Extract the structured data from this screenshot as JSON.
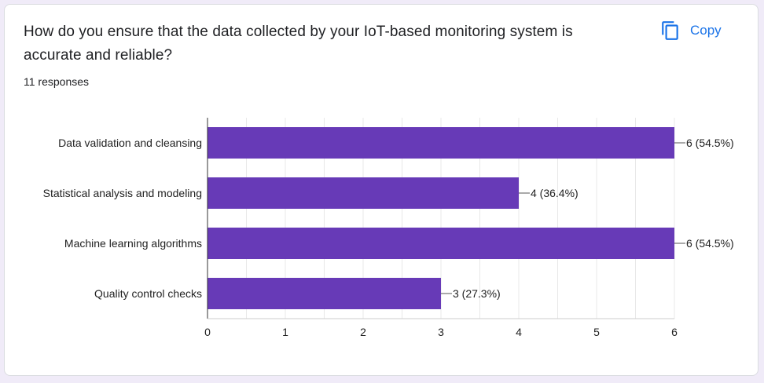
{
  "question": {
    "title": "How do you ensure that the data collected by your IoT-based monitoring system is accurate and reliable?",
    "responses": "11 responses"
  },
  "copy_button": {
    "label": "Copy",
    "icon": "copy-icon"
  },
  "colors": {
    "bar": "#673ab7",
    "accent": "#1a73e8",
    "background": "#f0ebf8",
    "grid": "#e8e8e8"
  },
  "chart_data": {
    "type": "bar",
    "orientation": "horizontal",
    "categories": [
      "Data validation and cleansing",
      "Statistical analysis and modeling",
      "Machine learning algorithms",
      "Quality control checks"
    ],
    "values": [
      6,
      4,
      6,
      3
    ],
    "value_labels": [
      "6 (54.5%)",
      "4 (36.4%)",
      "6 (54.5%)",
      "3 (27.3%)"
    ],
    "xlim": [
      0,
      6
    ],
    "xticks": [
      0,
      1,
      2,
      3,
      4,
      5,
      6
    ],
    "grid": true
  }
}
